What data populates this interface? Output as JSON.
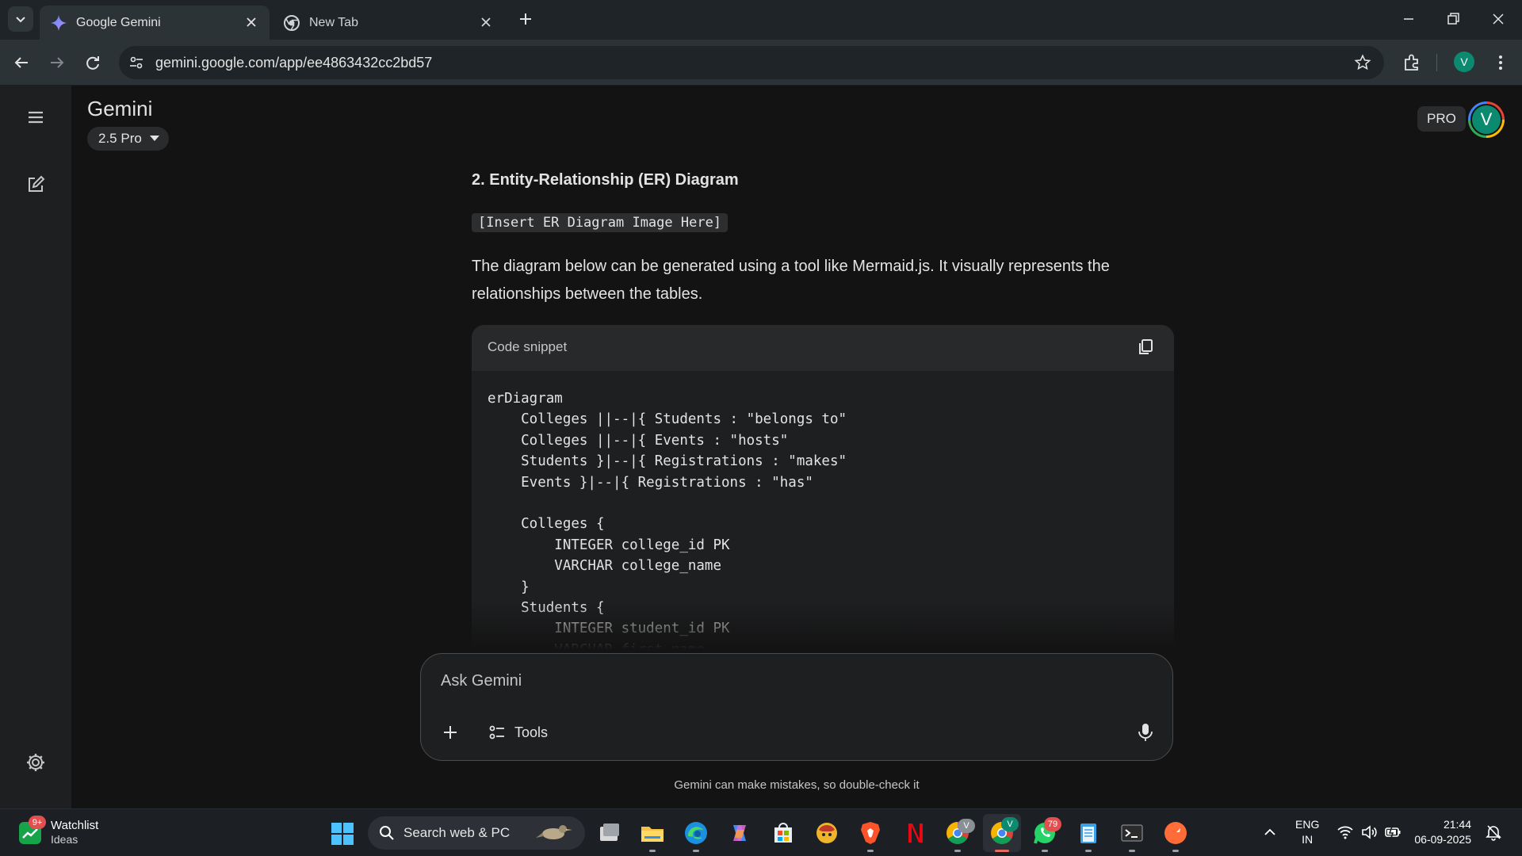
{
  "browser": {
    "tabs": [
      {
        "title": "Google Gemini",
        "active": true
      },
      {
        "title": "New Tab",
        "active": false
      }
    ],
    "url": "gemini.google.com/app/ee4863432cc2bd57",
    "profile_initial": "V"
  },
  "app": {
    "title": "Gemini",
    "model": "2.5 Pro",
    "plan_badge": "PRO",
    "user_initial": "V"
  },
  "content": {
    "heading": "2. Entity-Relationship (ER) Diagram",
    "placeholder_code": "[Insert ER Diagram Image Here]",
    "paragraph": "The diagram below can be generated using a tool like Mermaid.js. It visually represents the relationships between the tables.",
    "code_block": {
      "label": "Code snippet",
      "lines": [
        "erDiagram",
        "    Colleges ||--|{ Students : \"belongs to\"",
        "    Colleges ||--|{ Events : \"hosts\"",
        "    Students }|--|{ Registrations : \"makes\"",
        "    Events }|--|{ Registrations : \"has\"",
        "",
        "    Colleges {",
        "        INTEGER college_id PK",
        "        VARCHAR college_name",
        "    }",
        "    Students {",
        "        INTEGER student_id PK",
        "        VARCHAR first_name"
      ]
    }
  },
  "composer": {
    "placeholder": "Ask Gemini",
    "tools_label": "Tools",
    "disclaimer": "Gemini can make mistakes, so double-check it"
  },
  "taskbar": {
    "widget_title": "Watchlist",
    "widget_subtitle": "Ideas",
    "widget_badge": "9+",
    "search_placeholder": "Search web & PC",
    "whatsapp_badge": "79",
    "chrome_badge": "V",
    "language_top": "ENG",
    "language_bottom": "IN",
    "time": "21:44",
    "date": "06-09-2025"
  },
  "colors": {
    "chrome_dark": "#1e2427",
    "toolbar": "#2c3337",
    "app_bg": "#131314",
    "sidebar_bg": "#1e1f20",
    "accent_green": "#0b8a6f"
  }
}
